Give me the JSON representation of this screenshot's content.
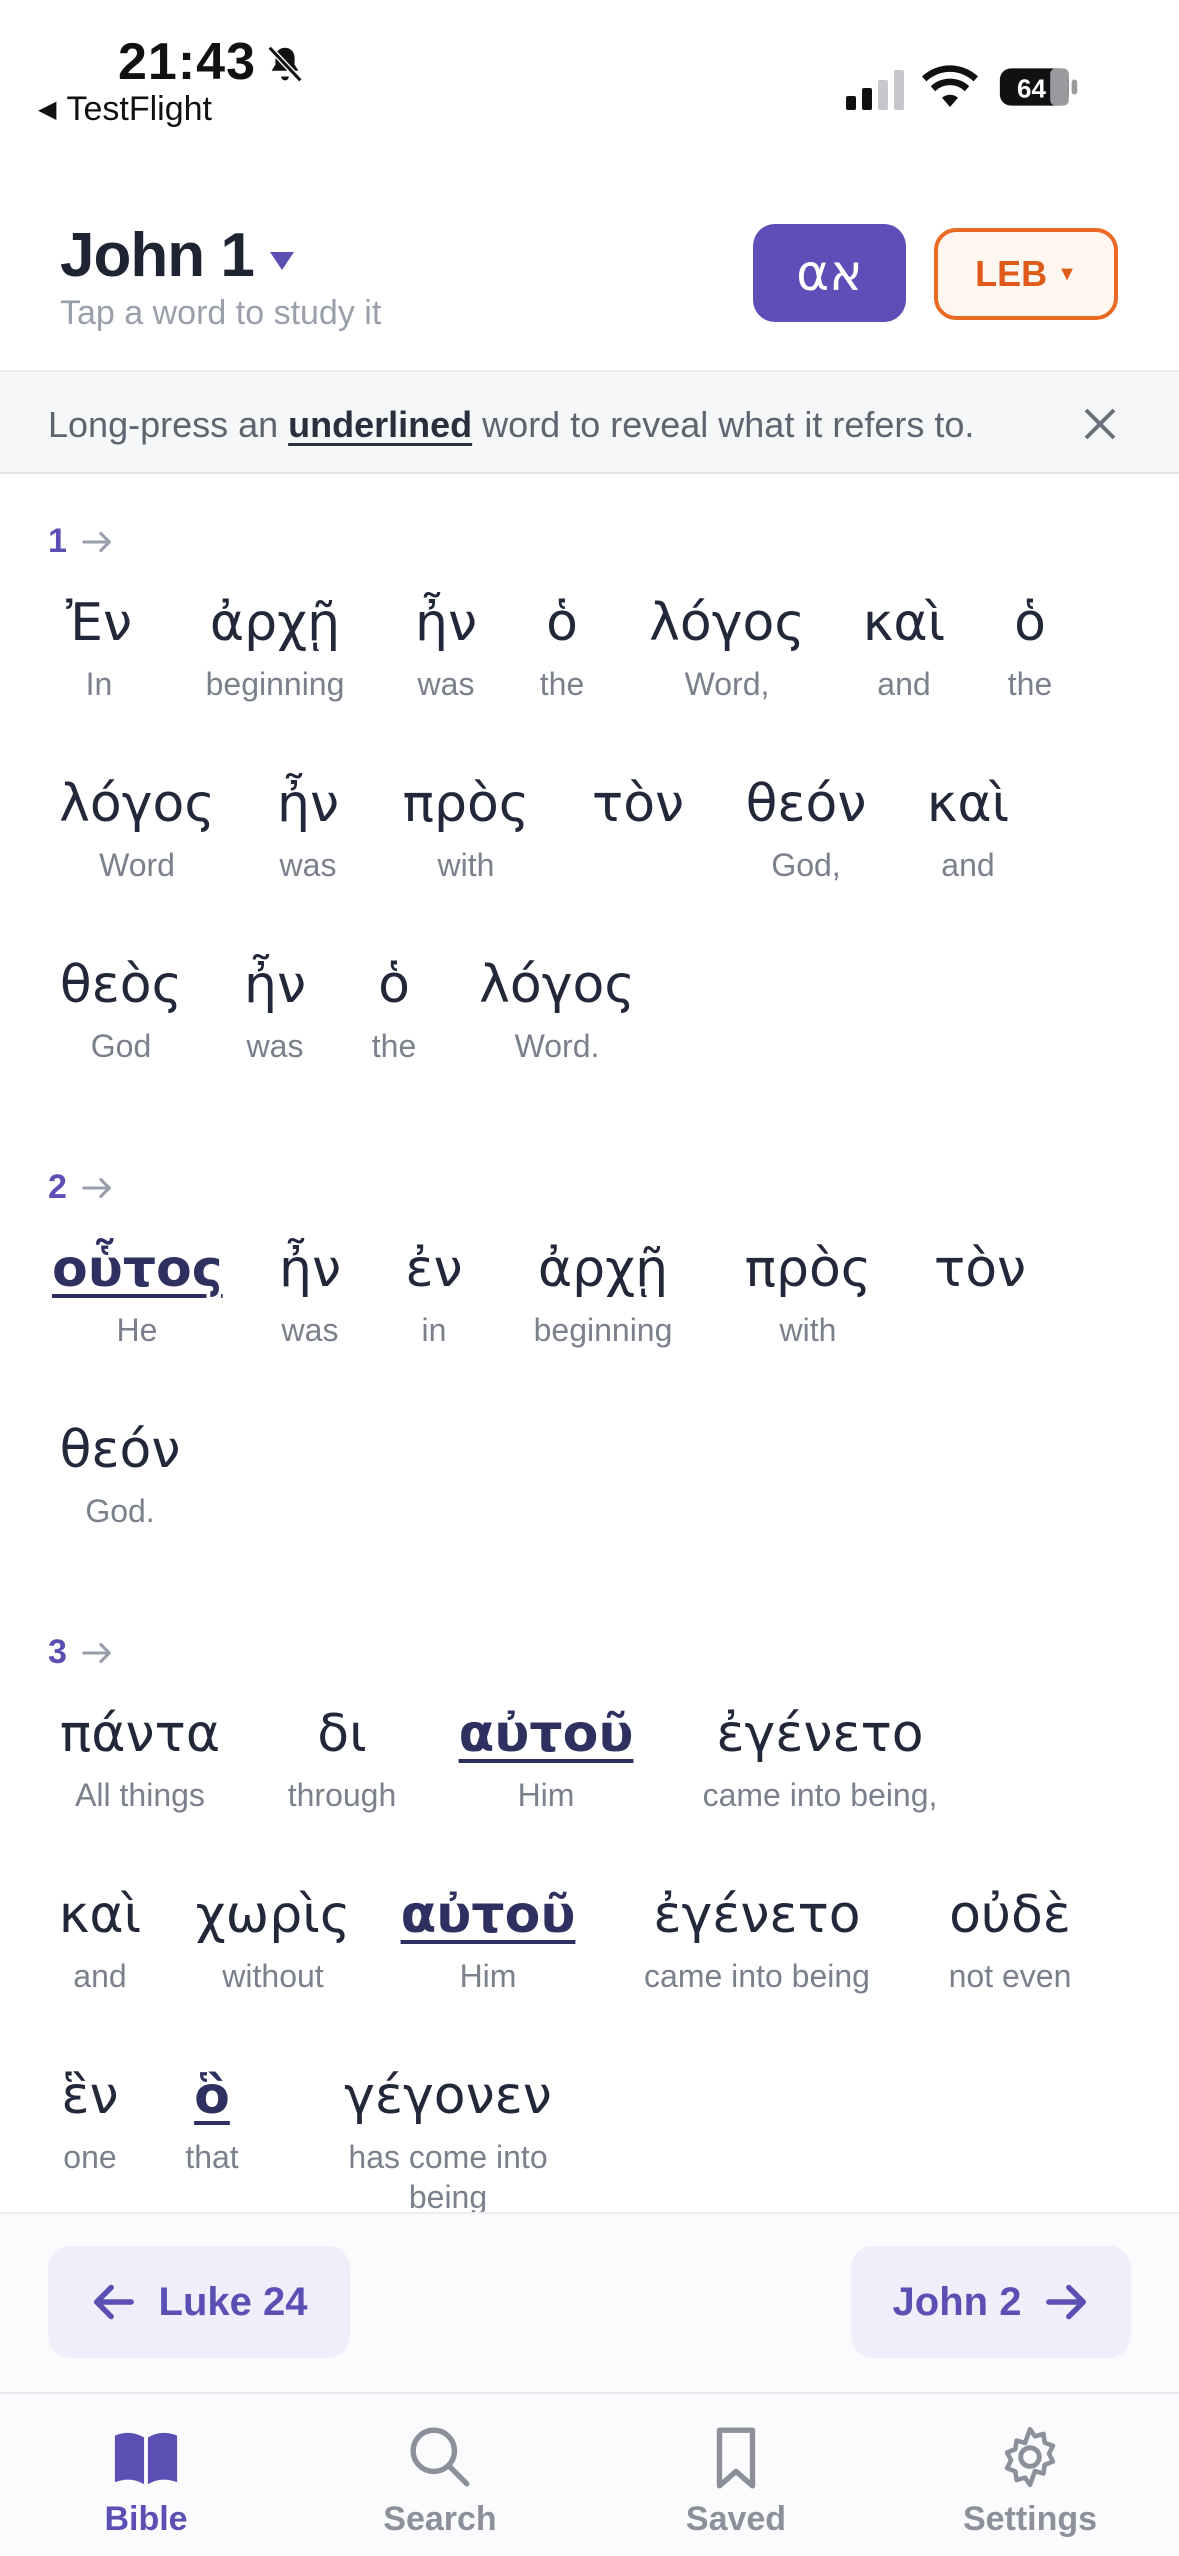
{
  "status_bar": {
    "time": "21:43",
    "back_app": "TestFlight",
    "battery": "64",
    "icons": [
      "bell-slash-icon",
      "cellular-signal-icon",
      "wifi-icon",
      "battery-icon"
    ]
  },
  "header": {
    "title": "John 1",
    "subtitle": "Tap a word to study it",
    "language_button": "αא",
    "version_button": "LEB",
    "accent": "#5e4fb8",
    "version_color": "#ea6a24"
  },
  "banner": {
    "text_before": "Long-press an ",
    "text_underlined": "underlined",
    "text_after": " word to reveal what it refers to."
  },
  "verses": [
    {
      "number": "1",
      "words": [
        {
          "greek": "Ἐν",
          "english": "In"
        },
        {
          "greek": "ἀρχῇ",
          "english": "beginning"
        },
        {
          "greek": "ἦν",
          "english": "was"
        },
        {
          "greek": "ὁ",
          "english": "the"
        },
        {
          "greek": "λόγος",
          "english": "Word,"
        },
        {
          "greek": "καὶ",
          "english": "and"
        },
        {
          "greek": "ὁ",
          "english": "the"
        },
        {
          "greek": "λόγος",
          "english": "Word"
        },
        {
          "greek": "ἦν",
          "english": "was"
        },
        {
          "greek": "πρὸς",
          "english": "with"
        },
        {
          "greek": "τὸν",
          "english": ""
        },
        {
          "greek": "θεόν",
          "english": "God,"
        },
        {
          "greek": "καὶ",
          "english": "and"
        },
        {
          "greek": "θεὸς",
          "english": "God"
        },
        {
          "greek": "ἦν",
          "english": "was"
        },
        {
          "greek": "ὁ",
          "english": "the"
        },
        {
          "greek": "λόγος",
          "english": "Word."
        }
      ]
    },
    {
      "number": "2",
      "words": [
        {
          "greek": "οὗτος",
          "english": "He",
          "underlined": true
        },
        {
          "greek": "ἦν",
          "english": "was"
        },
        {
          "greek": "ἐν",
          "english": "in"
        },
        {
          "greek": "ἀρχῇ",
          "english": "beginning"
        },
        {
          "greek": "πρὸς",
          "english": "with"
        },
        {
          "greek": "τὸν",
          "english": ""
        },
        {
          "greek": "θεόν",
          "english": "God."
        }
      ]
    },
    {
      "number": "3",
      "words": [
        {
          "greek": "πάντα",
          "english": "All things"
        },
        {
          "greek": "δι",
          "english": "through"
        },
        {
          "greek": "αὐτοῦ",
          "english": "Him",
          "underlined": true
        },
        {
          "greek": "ἐγένετο",
          "english": "came into being,"
        },
        {
          "greek": "καὶ",
          "english": "and"
        },
        {
          "greek": "χωρὶς",
          "english": "without"
        },
        {
          "greek": "αὐτοῦ",
          "english": "Him",
          "underlined": true
        },
        {
          "greek": "ἐγένετο",
          "english": "came into being"
        },
        {
          "greek": "οὐδὲ",
          "english": "not even"
        },
        {
          "greek": "ἓν",
          "english": "one"
        },
        {
          "greek": "ὃ",
          "english": "that",
          "underlined": true
        },
        {
          "greek": "γέγονεν",
          "english": "has come into being"
        }
      ]
    }
  ],
  "chapter_nav": {
    "prev": "Luke 24",
    "next": "John 2"
  },
  "tabs": [
    {
      "label": "Bible",
      "icon": "book-icon",
      "active": true
    },
    {
      "label": "Search",
      "icon": "search-icon",
      "active": false
    },
    {
      "label": "Saved",
      "icon": "bookmark-icon",
      "active": false
    },
    {
      "label": "Settings",
      "icon": "gear-icon",
      "active": false
    }
  ]
}
